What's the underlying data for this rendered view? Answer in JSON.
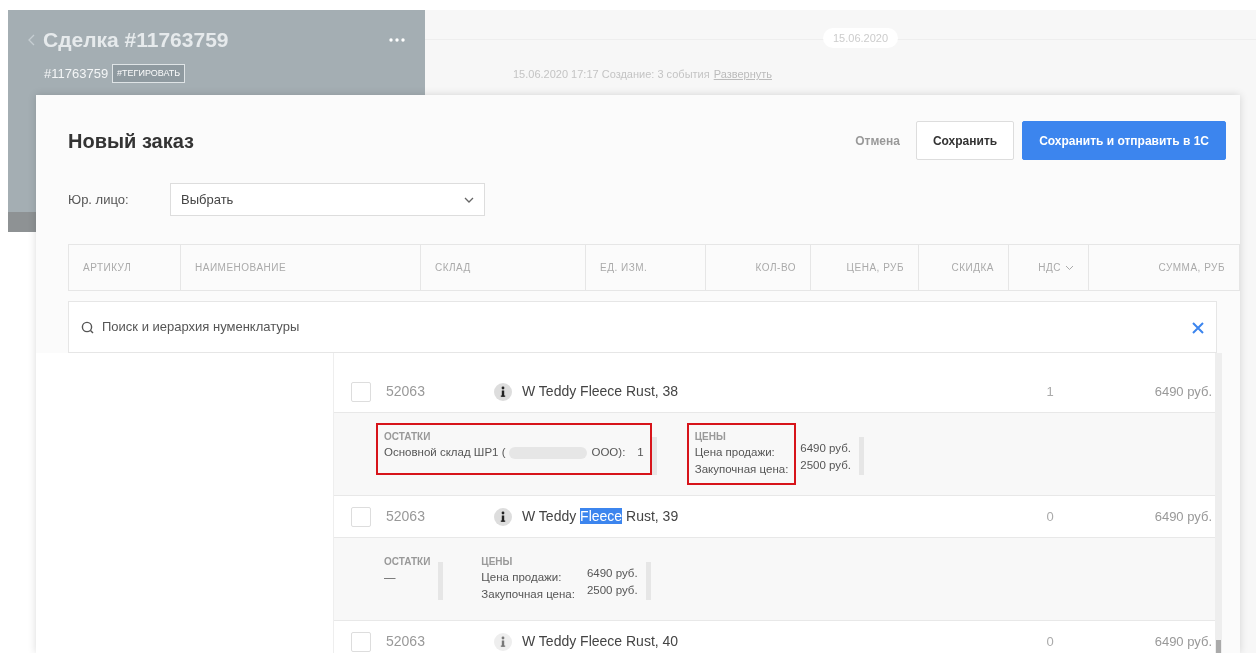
{
  "background": {
    "deal_title": "Сделка #11763759",
    "deal_id": "#11763759",
    "tag_button": "#ТЕГИРОВАТЬ",
    "date_badge": "15.06.2020",
    "event_text": "15.06.2020 17:17 Создание: 3 события",
    "event_link": "Развернуть"
  },
  "dialog": {
    "title": "Новый заказ",
    "buttons": [
      {
        "label": "Отмена",
        "kind": "link"
      },
      {
        "label": "Сохранить",
        "kind": "secondary"
      },
      {
        "label": "Сохранить и отправить в 1С",
        "kind": "primary"
      }
    ],
    "legal_entity": {
      "label": "Юр. лицо:",
      "value": "Выбрать"
    }
  },
  "table": {
    "columns": [
      {
        "label": "АРТИКУЛ",
        "dropdown": false
      },
      {
        "label": "НАИМЕНОВАНИЕ",
        "dropdown": false
      },
      {
        "label": "СКЛАД",
        "dropdown": false
      },
      {
        "label": "ЕД. ИЗМ.",
        "dropdown": false
      },
      {
        "label": "КОЛ-ВО",
        "dropdown": false
      },
      {
        "label": "ЦЕНА, РУБ",
        "dropdown": false
      },
      {
        "label": "СКИДКА",
        "dropdown": false
      },
      {
        "label": "НДС",
        "dropdown": true
      },
      {
        "label": "СУММА, РУБ",
        "dropdown": false
      }
    ]
  },
  "search": {
    "placeholder": "Поиск и иерархия нуменклатуры"
  },
  "items": [
    {
      "kind": "product",
      "checked": false,
      "info_active": true,
      "code": "52063",
      "name_parts": [
        {
          "text": "W Teddy Fleece Rust, 38",
          "selected": false
        }
      ],
      "qty": "1",
      "price": "6490 руб."
    },
    {
      "kind": "details",
      "stock_highlighted": true,
      "prices_highlighted": true,
      "stock_label": "ОСТАТКИ",
      "stock": [
        {
          "name": "Основной склад ШР1 (",
          "redacted": true,
          "name_end": "ООО):",
          "qty": "1"
        }
      ],
      "prices_label": "ЦЕНЫ",
      "prices": [
        {
          "label": "Цена продажи:",
          "value": "6490 руб."
        },
        {
          "label": "Закупочная цена:",
          "value": "2500 руб."
        }
      ]
    },
    {
      "kind": "product",
      "checked": false,
      "info_active": true,
      "code": "52063",
      "name_parts": [
        {
          "text": "W Teddy ",
          "selected": false
        },
        {
          "text": "Fleece",
          "selected": true
        },
        {
          "text": " Rust, 39",
          "selected": false
        }
      ],
      "qty": "0",
      "price": "6490 руб."
    },
    {
      "kind": "details",
      "stock_highlighted": false,
      "prices_highlighted": false,
      "stock_label": "ОСТАТКИ",
      "stock": [
        {
          "name": "—"
        }
      ],
      "prices_label": "ЦЕНЫ",
      "prices": [
        {
          "label": "Цена продажи:",
          "value": "6490 руб."
        },
        {
          "label": "Закупочная цена:",
          "value": "2500 руб."
        }
      ]
    },
    {
      "kind": "product",
      "checked": false,
      "info_active": false,
      "code": "52063",
      "name_parts": [
        {
          "text": "W Teddy Fleece Rust, 40",
          "selected": false
        }
      ],
      "qty": "0",
      "price": "6490 руб."
    }
  ]
}
